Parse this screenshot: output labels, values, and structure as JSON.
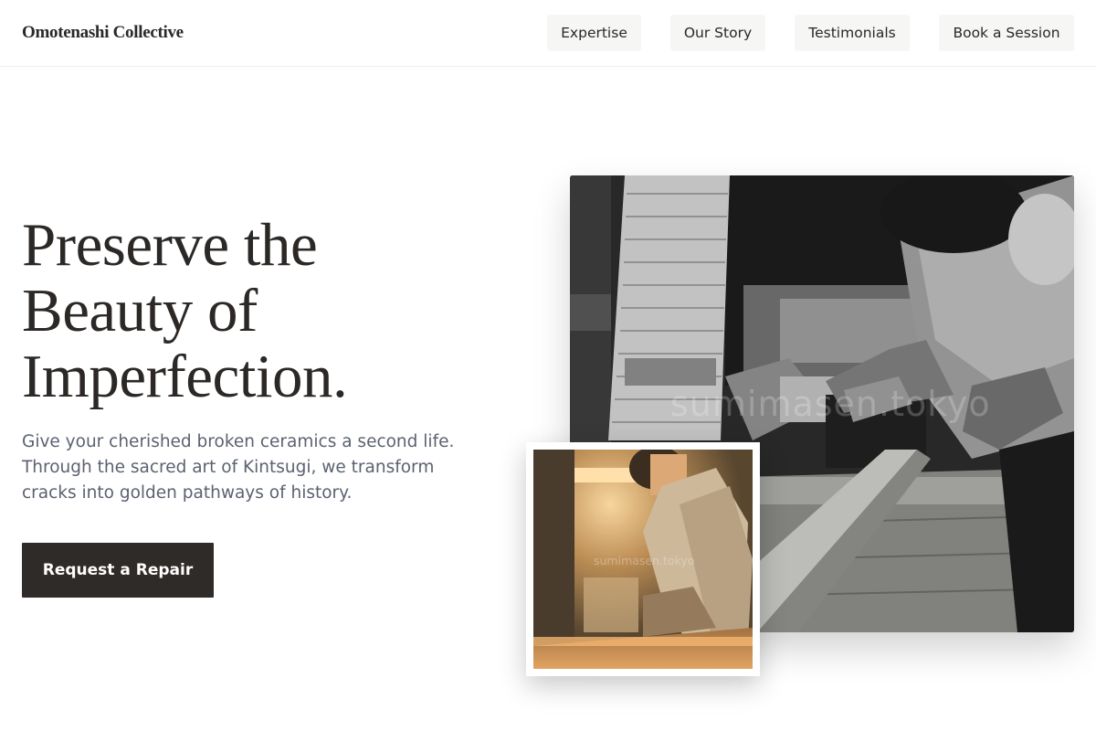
{
  "header": {
    "brand": "Omotenashi Collective",
    "nav": [
      "Expertise",
      "Our Story",
      "Testimonials",
      "Book a Session"
    ]
  },
  "hero": {
    "title_lines": [
      "Preserve the",
      "Beauty of",
      "Imperfection."
    ],
    "description_lines": [
      "Give your cherished broken ceramics a second life.",
      "Through the sacred art of Kintsugi, we transform",
      "cracks into golden pathways of history."
    ],
    "cta_label": "Request a Repair"
  },
  "images": {
    "main": {
      "subject": "craftsman planing wood in workshop (black and white)",
      "watermark": "sumimasen.tokyo"
    },
    "inset": {
      "subject": "craftsman working in warm-lit workshop",
      "watermark": "sumimasen.tokyo"
    }
  },
  "colors": {
    "text": "#2b2826",
    "muted": "#5b6270",
    "button_dark": "#2f2b28",
    "nav_bg": "#f6f6f5"
  }
}
